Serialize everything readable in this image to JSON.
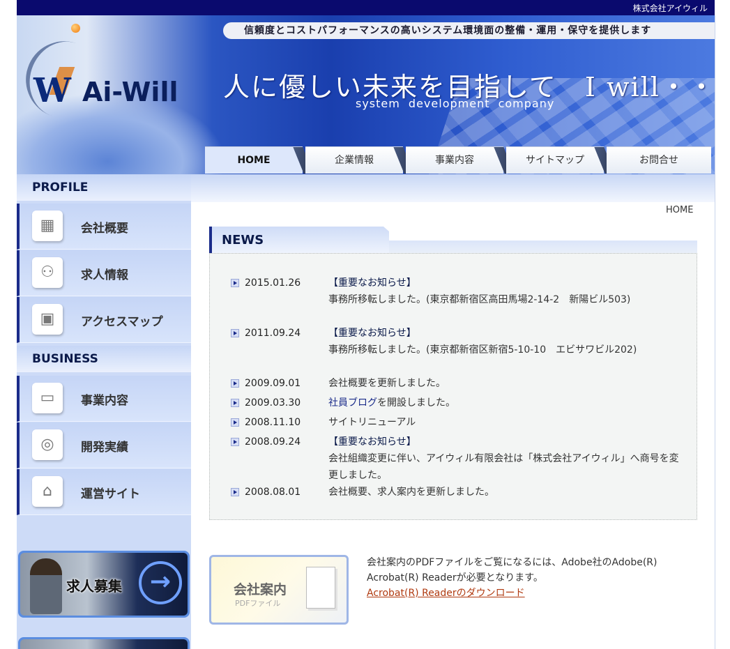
{
  "top_bar": {
    "company": "株式会社アイウィル"
  },
  "header": {
    "tagline": "信頼度とコストパフォーマンスの高いシステム環境面の整備・運用・保守を提供します",
    "logo_text": "Ai-Will",
    "catch_copy": "人に優しい未来を目指して　I will・・・",
    "catch_sub": "system development company"
  },
  "nav": {
    "tabs": [
      {
        "label": "HOME"
      },
      {
        "label": "企業情報"
      },
      {
        "label": "事業内容"
      },
      {
        "label": "サイトマップ"
      },
      {
        "label": "お問合せ"
      }
    ],
    "active": "HOME"
  },
  "sidebar": {
    "profile_title": "PROFILE",
    "profile_items": [
      {
        "label": "会社概要",
        "icon": "building-icon"
      },
      {
        "label": "求人情報",
        "icon": "people-icon"
      },
      {
        "label": "アクセスマップ",
        "icon": "train-icon"
      }
    ],
    "business_title": "BUSINESS",
    "business_items": [
      {
        "label": "事業内容",
        "icon": "folder-icon"
      },
      {
        "label": "開発実績",
        "icon": "disc-icon"
      },
      {
        "label": "運営サイト",
        "icon": "mouse-icon"
      }
    ],
    "banner": {
      "label": "求人募集"
    }
  },
  "breadcrumb": "HOME",
  "news": {
    "title": "NEWS",
    "items": [
      {
        "date": "2015.01.26",
        "headline": "【重要なお知らせ】",
        "body": "事務所移転しました。(東京都新宿区高田馬場2-14-2　新陽ビル503)"
      },
      {
        "date": "2011.09.24",
        "headline": "【重要なお知らせ】",
        "body": "事務所移転しました。(東京都新宿区新宿5-10-10　エビサワビル202)"
      },
      {
        "date": "2009.09.01",
        "body": "会社概要を更新しました。"
      },
      {
        "date": "2009.03.30",
        "link": "社員ブログ",
        "body": "を開設しました。"
      },
      {
        "date": "2008.11.10",
        "body": "サイトリニューアル"
      },
      {
        "date": "2008.09.24",
        "headline": "【重要なお知らせ】",
        "body": "会社組織変更に伴い、アイウィル有限会社は「株式会社アイウィル」へ商号を変更しました。"
      },
      {
        "date": "2008.08.01",
        "body": "会社概要、求人案内を更新しました。"
      }
    ]
  },
  "pdf": {
    "card_title": "会社案内",
    "card_sub": "PDFファイル",
    "text": "会社案内のPDFファイルをご覧になるには、Adobe社のAdobe(R) Acrobat(R) Readerが必要となります。",
    "link": "Acrobat(R) Readerのダウンロード"
  },
  "colors": {
    "nav_blue": "#1b2c8a",
    "topbar": "#0a0a6e",
    "link_orange": "#b03a10"
  }
}
